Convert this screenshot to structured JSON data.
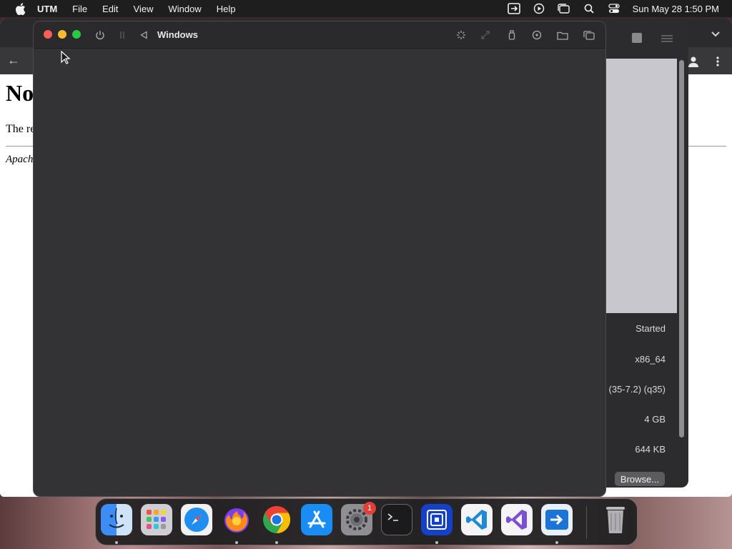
{
  "menubar": {
    "app_name": "UTM",
    "items": [
      "File",
      "Edit",
      "View",
      "Window",
      "Help"
    ],
    "clock": "Sun May 28  1:50 PM",
    "status_icons": [
      "utm-status-icon",
      "play-circle-icon",
      "window-stack-icon",
      "spotlight-search-icon",
      "control-center-icon"
    ]
  },
  "browser": {
    "heading_visible": "No",
    "paragraph_visible": "The re",
    "address_visible": "Apach"
  },
  "vm_window": {
    "title": "Windows",
    "toolbar_icons": [
      "power-icon",
      "pause-icon",
      "back-icon",
      "display-icon",
      "resize-icon",
      "usb-icon",
      "drive-icon",
      "shared-folder-icon",
      "windows-icon"
    ]
  },
  "utm_main": {
    "info": {
      "status": "Started",
      "architecture": "x86_64",
      "machine": "(35-7.2) (q35)",
      "memory": "4 GB",
      "size": "644 KB"
    },
    "browse_button": "Browse..."
  },
  "dock": {
    "apps": [
      "Finder",
      "Launchpad",
      "Safari",
      "Firefox",
      "Google Chrome",
      "App Store",
      "System Settings",
      "Terminal",
      "Remote Desktop",
      "Visual Studio Code",
      "Visual Studio",
      "UTM",
      "Trash"
    ],
    "settings_badge": "1"
  },
  "colors": {
    "vm_background": "#333335",
    "titlebar": "#2a2a2c",
    "menubar": "#1e1e1f",
    "close": "#ff5f57",
    "minimize": "#febc2e",
    "zoom": "#28c840"
  }
}
